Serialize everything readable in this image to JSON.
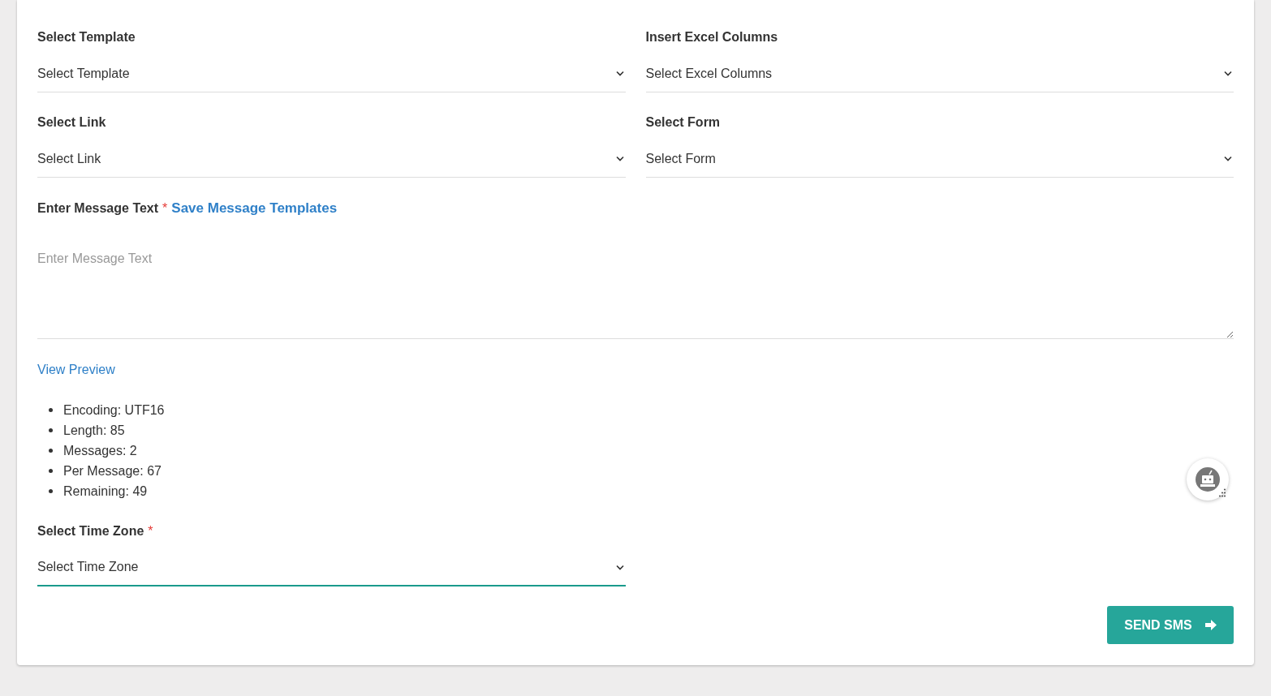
{
  "fields": [
    {
      "label": "Select Template",
      "value": "Select Template",
      "focused": false
    },
    {
      "label": "Insert Excel Columns",
      "value": "Select Excel Columns",
      "focused": false
    },
    {
      "label": "Select Link",
      "value": "Select Link",
      "focused": false
    },
    {
      "label": "Select Form",
      "value": "Select Form",
      "focused": false
    }
  ],
  "message": {
    "label": "Enter Message Text",
    "required_mark": "*",
    "link": "Save Message Templates",
    "placeholder": "Enter Message Text"
  },
  "preview_link": "View Preview",
  "stats": [
    "Encoding: UTF16",
    "Length: 85",
    "Messages: 2",
    "Per Message: 67",
    "Remaining: 49"
  ],
  "time_zone": {
    "label": "Select Time Zone",
    "required_mark": "*",
    "value": "Select Time Zone",
    "focused": true
  },
  "send_button": "SEND SMS"
}
